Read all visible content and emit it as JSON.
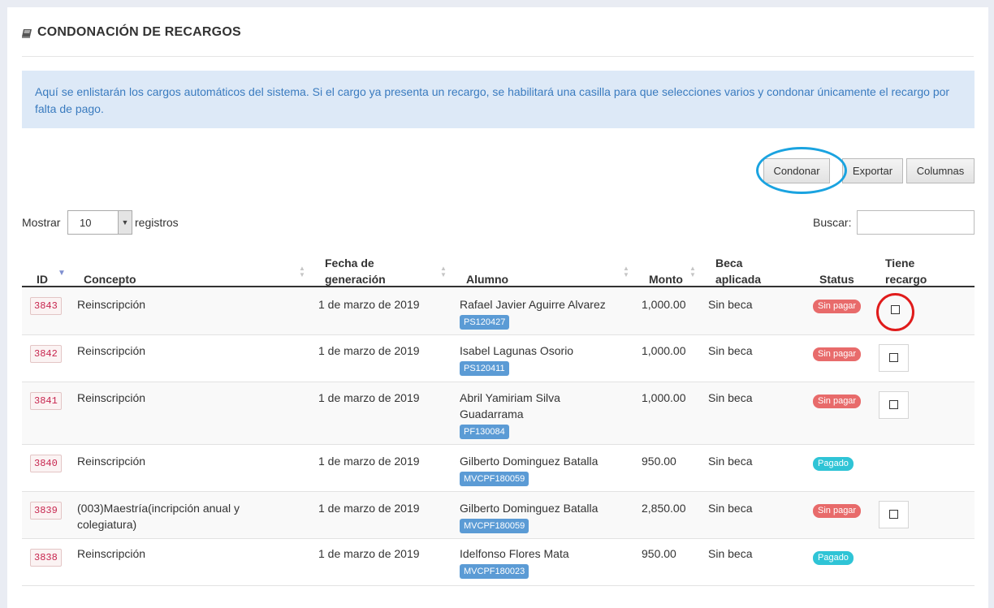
{
  "page": {
    "title": "CONDONACIÓN DE RECARGOS",
    "info_text": "Aquí se enlistarán los cargos automáticos del sistema. Si el cargo ya presenta un recargo, se habilitará una casilla para que selecciones varios y condonar únicamente el recargo por falta de pago."
  },
  "toolbar": {
    "condonar_label": "Condonar",
    "exportar_label": "Exportar",
    "columnas_label": "Columnas"
  },
  "controls": {
    "show_label": "Mostrar",
    "page_length": "10",
    "records_label": "registros",
    "search_label": "Buscar:",
    "search_value": ""
  },
  "table": {
    "headers": {
      "id": "ID",
      "concepto": "Concepto",
      "fecha_line1": "Fecha de",
      "fecha_line2": "generación",
      "alumno": "Alumno",
      "monto": "Monto",
      "beca_line1": "Beca",
      "beca_line2": "aplicada",
      "status": "Status",
      "recargo_line1": "Tiene",
      "recargo_line2": "recargo"
    },
    "rows": [
      {
        "id": "3843",
        "concepto": "Reinscripción",
        "fecha": "1 de marzo de 2019",
        "alumno": "Rafael Javier Aguirre Alvarez",
        "matricula": "PS120427",
        "monto": "1,000.00",
        "beca": "Sin beca",
        "status": "Sin pagar",
        "status_color": "#e86b6b",
        "has_checkbox": true
      },
      {
        "id": "3842",
        "concepto": "Reinscripción",
        "fecha": "1 de marzo de 2019",
        "alumno": "Isabel Lagunas Osorio",
        "matricula": "PS120411",
        "monto": "1,000.00",
        "beca": "Sin beca",
        "status": "Sin pagar",
        "status_color": "#e86b6b",
        "has_checkbox": true
      },
      {
        "id": "3841",
        "concepto": "Reinscripción",
        "fecha": "1 de marzo de 2019",
        "alumno": "Abril Yamiriam Silva Guadarrama",
        "matricula": "PF130084",
        "monto": "1,000.00",
        "beca": "Sin beca",
        "status": "Sin pagar",
        "status_color": "#e86b6b",
        "has_checkbox": true
      },
      {
        "id": "3840",
        "concepto": "Reinscripción",
        "fecha": "1 de marzo de 2019",
        "alumno": "Gilberto Dominguez Batalla",
        "matricula": "MVCPF180059",
        "monto": "950.00",
        "beca": "Sin beca",
        "status": "Pagado",
        "status_color": "#2fc4d6",
        "has_checkbox": false
      },
      {
        "id": "3839",
        "concepto": "(003)Maestría(incripción anual y colegiatura)",
        "fecha": "1 de marzo de 2019",
        "alumno": "Gilberto Dominguez Batalla",
        "matricula": "MVCPF180059",
        "monto": "2,850.00",
        "beca": "Sin beca",
        "status": "Sin pagar",
        "status_color": "#e86b6b",
        "has_checkbox": true
      },
      {
        "id": "3838",
        "concepto": "Reinscripción",
        "fecha": "1 de marzo de 2019",
        "alumno": "Idelfonso Flores Mata",
        "matricula": "MVCPF180023",
        "monto": "950.00",
        "beca": "Sin beca",
        "status": "Pagado",
        "status_color": "#2fc4d6",
        "has_checkbox": false
      }
    ]
  },
  "colors": {
    "info_bg": "#dde9f7",
    "info_text": "#3a7bbf",
    "id_tag_text": "#c7254e",
    "matricula_tag": "#5b9bd5",
    "highlight_blue": "#1aa3e0",
    "highlight_red": "#e01b1b"
  }
}
